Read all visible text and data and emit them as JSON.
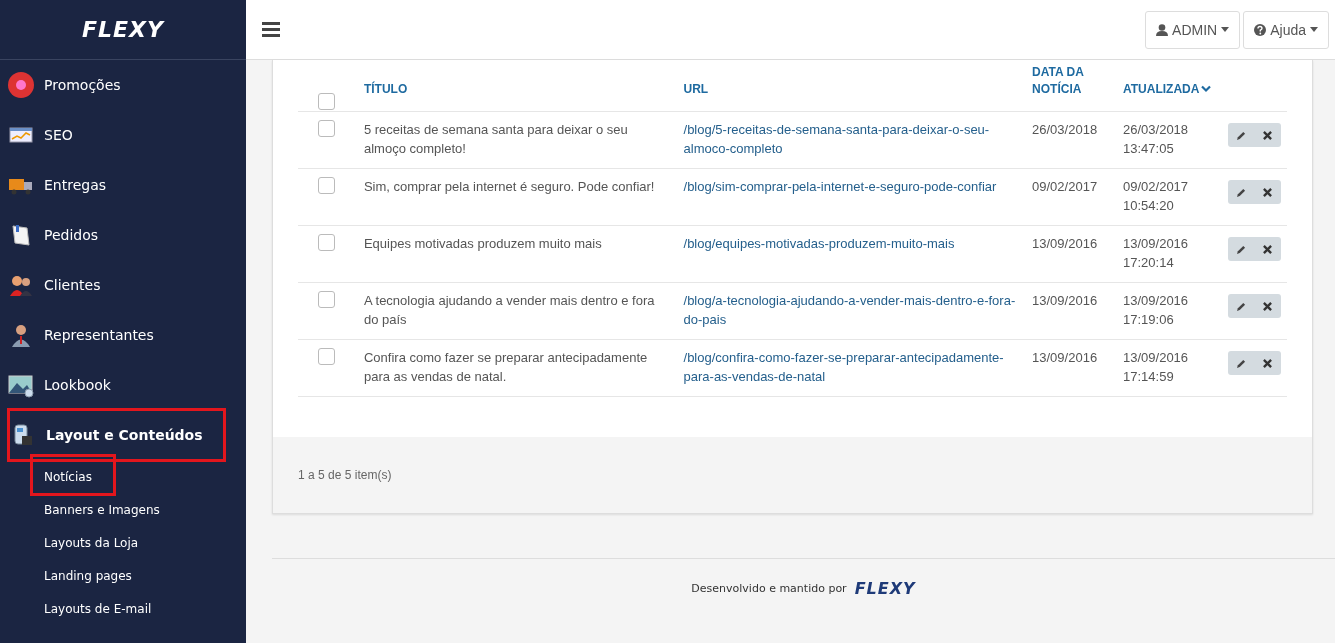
{
  "sidebar": {
    "logo": "FLEXY",
    "items": [
      {
        "label": "Promoções",
        "highlighted": false
      },
      {
        "label": "SEO",
        "highlighted": false
      },
      {
        "label": "Entregas",
        "highlighted": false
      },
      {
        "label": "Pedidos",
        "highlighted": false
      },
      {
        "label": "Clientes",
        "highlighted": false
      },
      {
        "label": "Representantes",
        "highlighted": false
      },
      {
        "label": "Lookbook",
        "highlighted": false
      },
      {
        "label": "Layout e Conteúdos",
        "highlighted": true,
        "expanded": true,
        "children": [
          {
            "label": "Notícias",
            "highlighted": true
          },
          {
            "label": "Banners e Imagens",
            "highlighted": false
          },
          {
            "label": "Layouts da Loja",
            "highlighted": false
          },
          {
            "label": "Landing pages",
            "highlighted": false
          },
          {
            "label": "Layouts de E-mail",
            "highlighted": false
          }
        ]
      }
    ]
  },
  "header": {
    "user_button": "ADMIN",
    "help_button": "Ajuda"
  },
  "table": {
    "columns": [
      {
        "kind": "checkbox",
        "checked": false
      },
      {
        "kind": "text",
        "label": "TÍTULO",
        "sorted": false
      },
      {
        "kind": "text",
        "label": "URL",
        "sorted": false
      },
      {
        "kind": "text",
        "label": "DATA DA NOTÍCIA",
        "sorted": false
      },
      {
        "kind": "text",
        "label": "ATUALIZADA",
        "sorted": true
      },
      {
        "kind": "actions"
      }
    ],
    "rows": [
      {
        "checked": false,
        "title": "5 receitas de semana santa para deixar o seu almoço completo!",
        "url": "/blog/5-receitas-de-semana-santa-para-deixar-o-seu-almoco-completo",
        "date": "26/03/2018",
        "updated": "26/03/2018 13:47:05"
      },
      {
        "checked": false,
        "title": "Sim, comprar pela internet é seguro. Pode confiar!",
        "url": "/blog/sim-comprar-pela-internet-e-seguro-pode-confiar",
        "date": "09/02/2017",
        "updated": "09/02/2017 10:54:20"
      },
      {
        "checked": false,
        "title": "Equipes motivadas produzem muito mais",
        "url": "/blog/equipes-motivadas-produzem-muito-mais",
        "date": "13/09/2016",
        "updated": "13/09/2016 17:20:14"
      },
      {
        "checked": false,
        "title": "A tecnologia ajudando a vender mais dentro e fora do país",
        "url": "/blog/a-tecnologia-ajudando-a-vender-mais-dentro-e-fora-do-pais",
        "date": "13/09/2016",
        "updated": "13/09/2016 17:19:06"
      },
      {
        "checked": false,
        "title": "Confira como fazer se preparar antecipadamente para as vendas de natal.",
        "url": "/blog/confira-como-fazer-se-preparar-antecipadamente-para-as-vendas-de-natal",
        "date": "13/09/2016",
        "updated": "13/09/2016 17:14:59"
      }
    ],
    "summary": "1 a 5 de 5 item(s)"
  },
  "footer": {
    "text": "Desenvolvido e mantido por",
    "logo": "FLEXY"
  }
}
